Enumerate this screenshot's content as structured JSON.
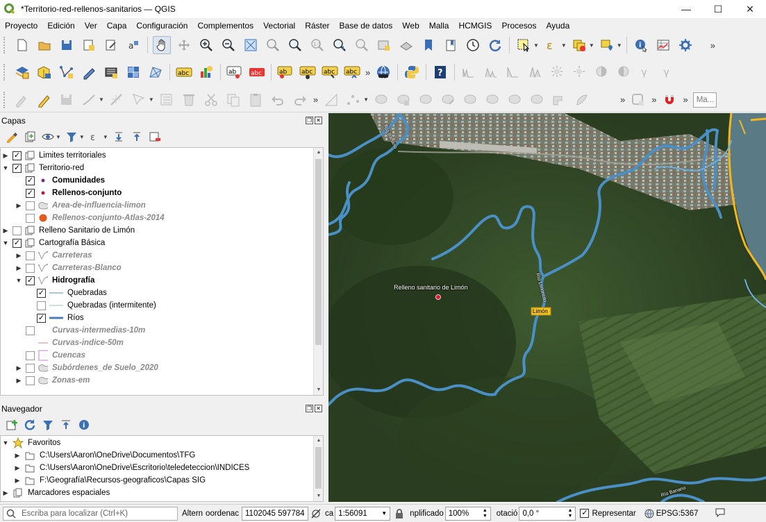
{
  "window": {
    "title": "*Territorio-red-rellenos-sanitarios — QGIS",
    "controls": [
      "—",
      "☐",
      "✕"
    ]
  },
  "menu": [
    "Proyecto",
    "Edición",
    "Ver",
    "Capa",
    "Configuración",
    "Complementos",
    "Vectorial",
    "Ráster",
    "Base de datos",
    "Web",
    "Malla",
    "HCMGIS",
    "Procesos",
    "Ayuda"
  ],
  "toolbar3": {
    "search_placeholder": "Ma..."
  },
  "layers_panel": {
    "title": "Capas",
    "items": [
      {
        "label": "Limites territoriales",
        "level": 0,
        "expand": "▶",
        "checked": true,
        "icon": "group-icon",
        "style": "normal"
      },
      {
        "label": "Territorio-red",
        "level": 0,
        "expand": "▼",
        "checked": true,
        "icon": "group-icon",
        "style": "normal"
      },
      {
        "label": "Comunidades",
        "level": 1,
        "expand": "",
        "checked": true,
        "icon": "point-purple-icon",
        "style": "bold"
      },
      {
        "label": "Rellenos-conjunto",
        "level": 1,
        "expand": "",
        "checked": true,
        "icon": "point-red-icon",
        "style": "bold"
      },
      {
        "label": "Area-de-influencia-limon",
        "level": 1,
        "expand": "▶",
        "checked": false,
        "icon": "polygon-icon",
        "style": "italic"
      },
      {
        "label": "Rellenos-conjunto-Atlas-2014",
        "level": 1,
        "expand": "",
        "checked": false,
        "icon": "point-orange-icon",
        "style": "italic"
      },
      {
        "label": "Relleno Sanitario de Limón",
        "level": 0,
        "expand": "▶",
        "checked": false,
        "icon": "group-icon",
        "style": "normal"
      },
      {
        "label": "Cartografía Básica",
        "level": 0,
        "expand": "▼",
        "checked": true,
        "icon": "group-icon",
        "style": "normal"
      },
      {
        "label": "Carreteras",
        "level": 1,
        "expand": "▶",
        "checked": false,
        "icon": "line-icon",
        "style": "italic"
      },
      {
        "label": "Carreteras-Blanco",
        "level": 1,
        "expand": "▶",
        "checked": false,
        "icon": "line-icon",
        "style": "italic"
      },
      {
        "label": "Hidrografía",
        "level": 1,
        "expand": "▼",
        "checked": true,
        "icon": "line-icon",
        "style": "bold"
      },
      {
        "label": "Quebradas",
        "level": 2,
        "expand": "",
        "checked": true,
        "icon": "legend-thin-blue",
        "style": "normal"
      },
      {
        "label": "Quebradas (intermitente)",
        "level": 2,
        "expand": "",
        "checked": false,
        "icon": "legend-thin-light",
        "style": "normal"
      },
      {
        "label": "Ríos",
        "level": 2,
        "expand": "",
        "checked": true,
        "icon": "legend-thick-blue",
        "style": "normal"
      },
      {
        "label": "Curvas-intermedias-10m",
        "level": 1,
        "expand": "",
        "checked": false,
        "icon": "none",
        "style": "italic"
      },
      {
        "label": "Curvas-indice-50m",
        "level": 1,
        "expand": "",
        "checked": null,
        "icon": "legend-brown",
        "style": "italic"
      },
      {
        "label": "Cuencas",
        "level": 1,
        "expand": "",
        "checked": false,
        "icon": "purple-square",
        "style": "italic"
      },
      {
        "label": "Subórdenes_de Suelo_2020",
        "level": 1,
        "expand": "▶",
        "checked": false,
        "icon": "polygon-icon",
        "style": "italic"
      },
      {
        "label": "Zonas-em",
        "level": 1,
        "expand": "▶",
        "checked": false,
        "icon": "polygon-icon",
        "style": "italic"
      }
    ]
  },
  "navigator_panel": {
    "title": "Navegador",
    "items": [
      {
        "label": "Favoritos",
        "level": 0,
        "expand": "▼",
        "icon": "star-icon"
      },
      {
        "label": "C:\\Users\\Aaron\\OneDrive\\Documentos\\TFG",
        "level": 1,
        "expand": "▶",
        "icon": "folder-icon"
      },
      {
        "label": "C:\\Users\\Aaron\\OneDrive\\Escritorio\\teledeteccion\\INDICES",
        "level": 1,
        "expand": "▶",
        "icon": "folder-icon"
      },
      {
        "label": "F:\\Geografía\\Recursos-geograficos\\Capas SIG",
        "level": 1,
        "expand": "▶",
        "icon": "folder-icon"
      },
      {
        "label": "Marcadores espaciales",
        "level": 0,
        "expand": "▶",
        "icon": "bookmark-icon"
      }
    ]
  },
  "map": {
    "labels": {
      "landfill": "Relleno sanitario de Limón",
      "city": "Limón",
      "river_top": "Río Banano",
      "river_mid": "Río Limoncito",
      "river_bottom": "Río Banano"
    }
  },
  "statusbar": {
    "locator_placeholder": "Escriba para localizar (Ctrl+K)",
    "altern_label": "Altern",
    "coordinate_label": "oordenac",
    "coordinate_value": "1102045  597784",
    "scale_label": "ca",
    "scale_value": "1:56091",
    "magnifier_label": "nplificado",
    "magnifier_value": "100%",
    "rotation_label": "otació",
    "rotation_value": "0,0 °",
    "render_label": "Representar",
    "crs": "EPSG:5367"
  }
}
